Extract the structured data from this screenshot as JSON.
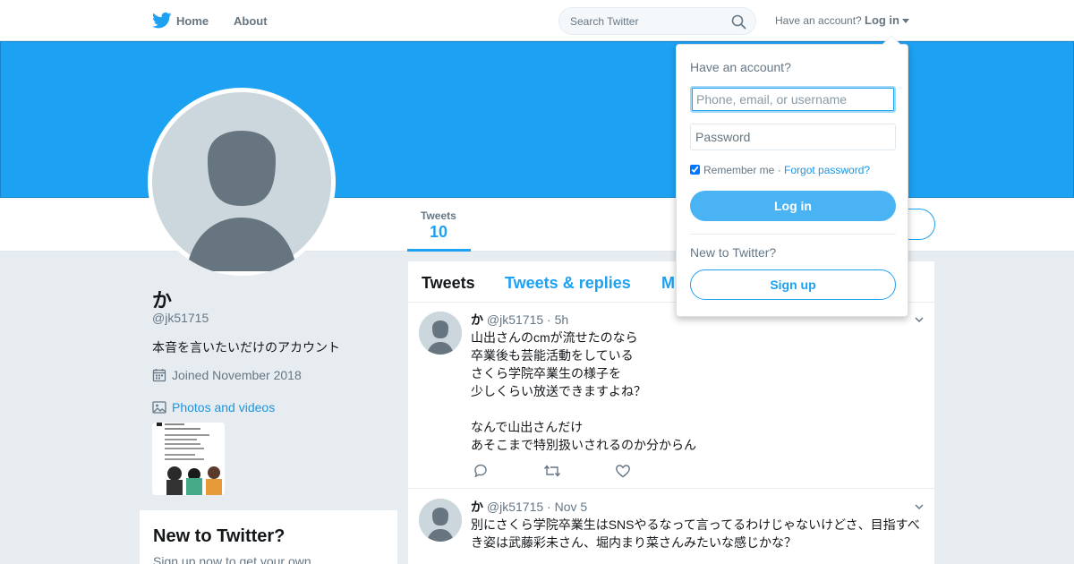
{
  "nav": {
    "home_label": "Home",
    "about_label": "About",
    "search_placeholder": "Search Twitter",
    "have_account": "Have an account?",
    "login_label": "Log in"
  },
  "profile": {
    "name": "か",
    "handle": "@jk51715",
    "bio": "本音を言いたいだけのアカウント",
    "joined": "Joined November 2018",
    "photos_label": "Photos and videos",
    "stats": [
      {
        "label": "Tweets",
        "value": "10"
      }
    ]
  },
  "new_to_twitter": {
    "title": "New to Twitter?",
    "text": "Sign up now to get your own"
  },
  "timeline": {
    "tabs": [
      "Tweets",
      "Tweets & replies",
      "M"
    ],
    "tweets": [
      {
        "name": "か",
        "handle": "@jk51715",
        "time": "· 5h",
        "lines": [
          "山出さんのcmが流せたのなら",
          "卒業後も芸能活動をしている",
          "さくら学院卒業生の様子を",
          "少しくらい放送できますよね？",
          "",
          "なんで山出さんだけ",
          "あそこまで特別扱いされるのか分からん"
        ]
      },
      {
        "name": "か",
        "handle": "@jk51715",
        "time": "· Nov 5",
        "lines": [
          "別にさくら学院卒業生はSNSやるなって言ってるわけじゃないけどさ、目指すべ",
          "き姿は武藤彩未さん、堀内まり菜さんみたいな感じかな？"
        ]
      }
    ]
  },
  "login_dropdown": {
    "title": "Have an account?",
    "username_placeholder": "Phone, email, or username",
    "password_placeholder": "Password",
    "remember_label": "Remember me",
    "separator": " · ",
    "forgot_label": "Forgot password?",
    "login_button": "Log in",
    "new_label": "New to Twitter?",
    "signup_button": "Sign up"
  },
  "colors": {
    "brand": "#1da1f2",
    "banner": "#1da1f2",
    "background": "#e6ecf0"
  }
}
